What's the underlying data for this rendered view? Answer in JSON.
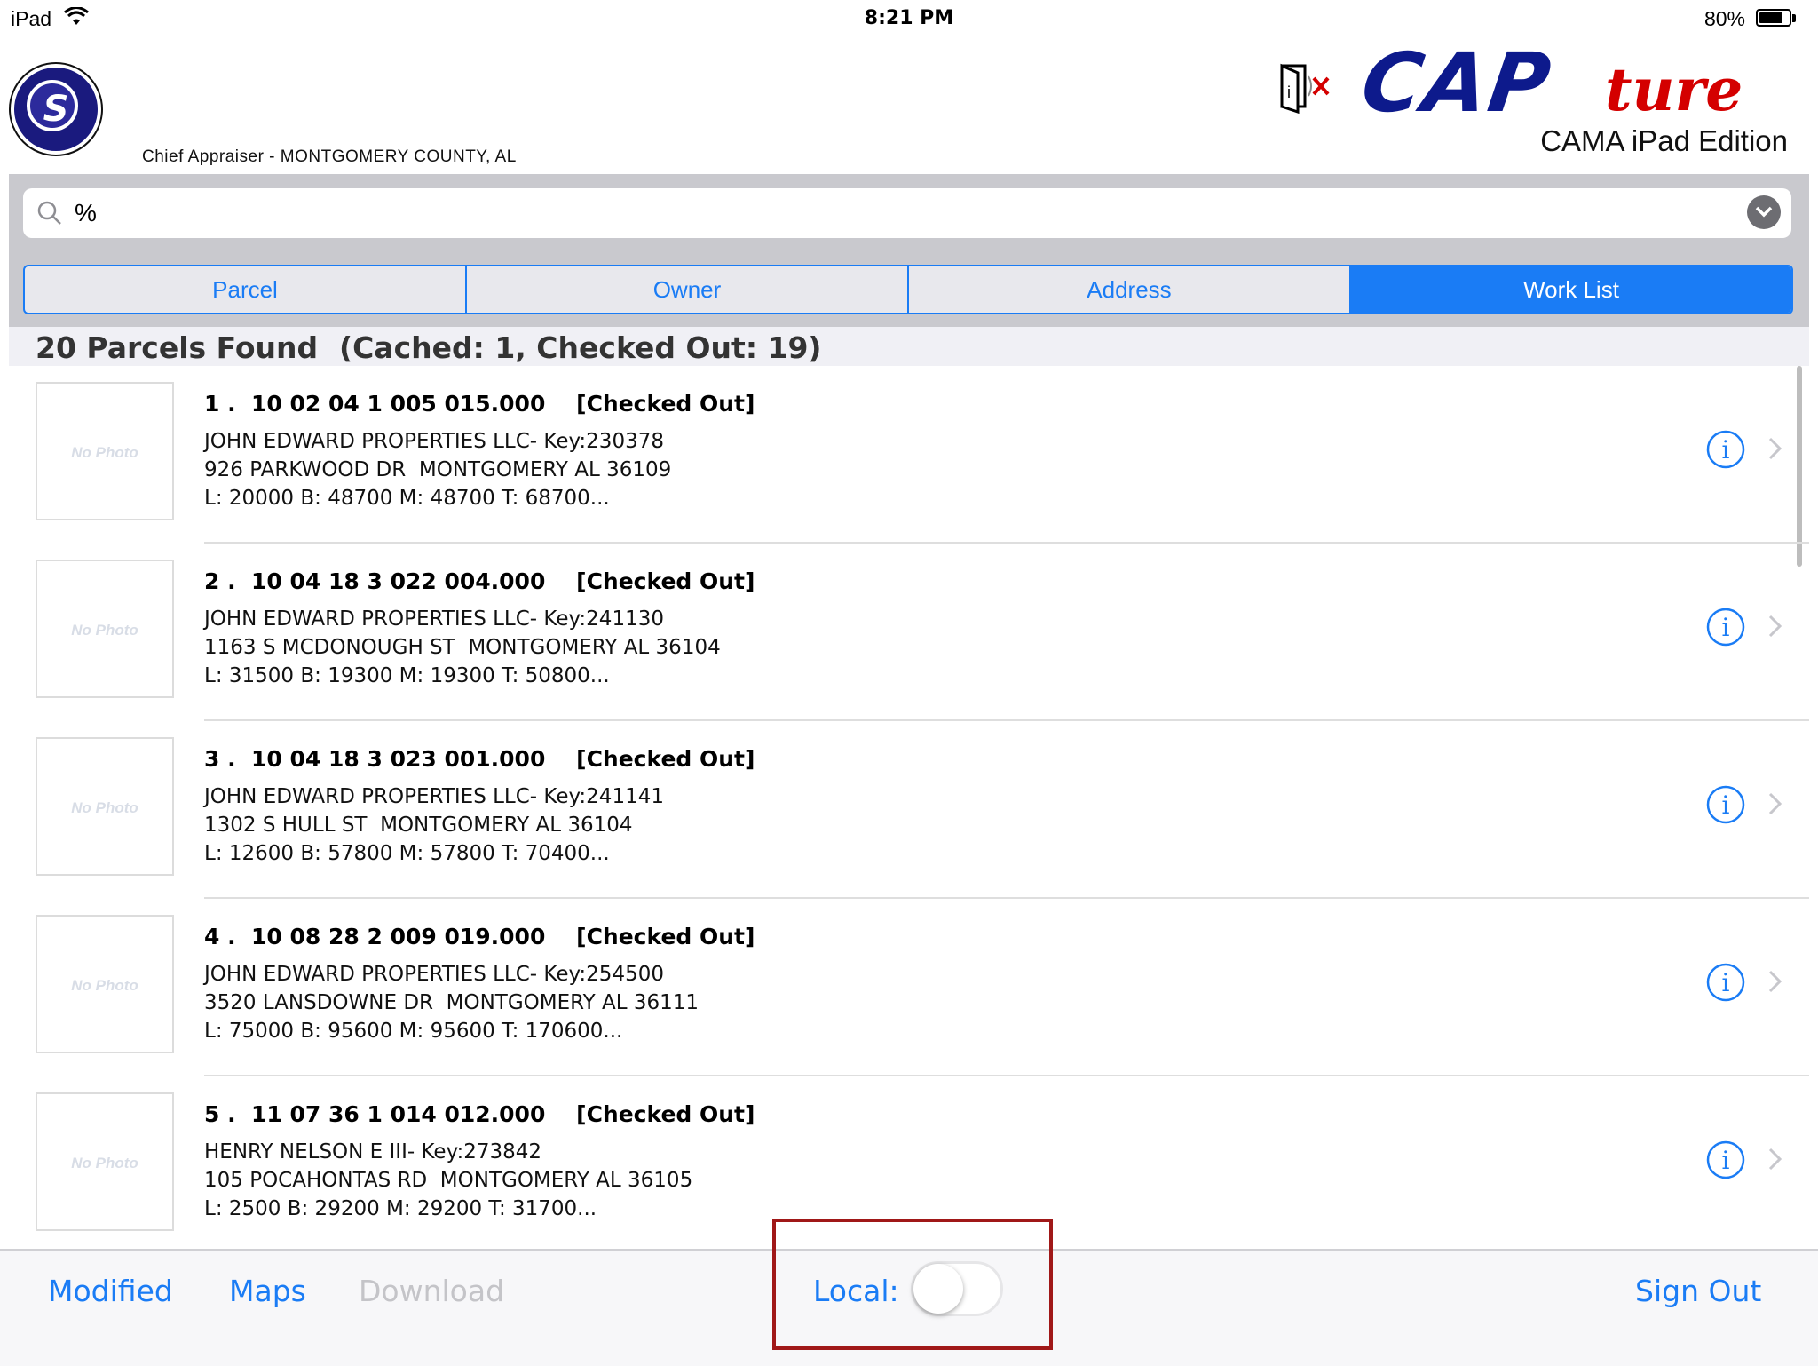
{
  "status_bar": {
    "carrier": "iPad",
    "time": "8:21 PM",
    "battery": "80%",
    "battery_level": 0.8
  },
  "header": {
    "agency": "Chief Appraiser - MONTGOMERY COUNTY, AL",
    "brand": "CAP",
    "brand_script": "ture",
    "edition": "CAMA iPad Edition",
    "logo_letter": "S"
  },
  "search": {
    "value": "%"
  },
  "tabs": [
    {
      "label": "Parcel",
      "active": false
    },
    {
      "label": "Owner",
      "active": false
    },
    {
      "label": "Address",
      "active": false
    },
    {
      "label": "Work List",
      "active": true
    }
  ],
  "results": {
    "found": "20  Parcels Found",
    "cached": "(Cached: 1, Checked Out: 19)"
  },
  "parcels": [
    {
      "title": "1 .  10 02 04 1 005 015.000    [Checked Out]",
      "owner": "JOHN EDWARD PROPERTIES LLC- Key:230378",
      "address": "926 PARKWOOD DR  MONTGOMERY AL 36109",
      "values": "L: 20000 B: 48700 M: 48700 T: 68700...",
      "photo": "No Photo"
    },
    {
      "title": "2 .  10 04 18 3 022 004.000    [Checked Out]",
      "owner": "JOHN EDWARD PROPERTIES LLC- Key:241130",
      "address": "1163 S MCDONOUGH ST  MONTGOMERY AL 36104",
      "values": "L: 31500 B: 19300 M: 19300 T: 50800...",
      "photo": "No Photo"
    },
    {
      "title": "3 .  10 04 18 3 023 001.000    [Checked Out]",
      "owner": "JOHN EDWARD PROPERTIES LLC- Key:241141",
      "address": "1302 S HULL ST  MONTGOMERY AL 36104",
      "values": "L: 12600 B: 57800 M: 57800 T: 70400...",
      "photo": "No Photo"
    },
    {
      "title": "4 .  10 08 28 2 009 019.000    [Checked Out]",
      "owner": "JOHN EDWARD PROPERTIES LLC- Key:254500",
      "address": "3520 LANSDOWNE DR  MONTGOMERY AL 36111",
      "values": "L: 75000 B: 95600 M: 95600 T: 170600...",
      "photo": "No Photo"
    },
    {
      "title": "5 .  11 07 36 1 014 012.000    [Checked Out]",
      "owner": "HENRY NELSON E III- Key:273842",
      "address": "105 POCAHONTAS RD  MONTGOMERY AL 36105",
      "values": "L: 2500 B: 29200 M: 29200 T: 31700...",
      "photo": "No Photo"
    }
  ],
  "toolbar": {
    "modified": "Modified",
    "maps": "Maps",
    "download": "Download",
    "local": "Local:",
    "local_on": false,
    "sign_out": "Sign Out"
  },
  "colors": {
    "accent": "#1a7cf5",
    "brand_blue": "#0d1a8c",
    "brand_red": "#d40000",
    "highlight": "#a01818"
  },
  "icons": [
    "wifi-icon",
    "battery-icon",
    "door-info-icon",
    "search-icon",
    "chevron-down-icon",
    "info-icon",
    "chevron-right-icon"
  ]
}
